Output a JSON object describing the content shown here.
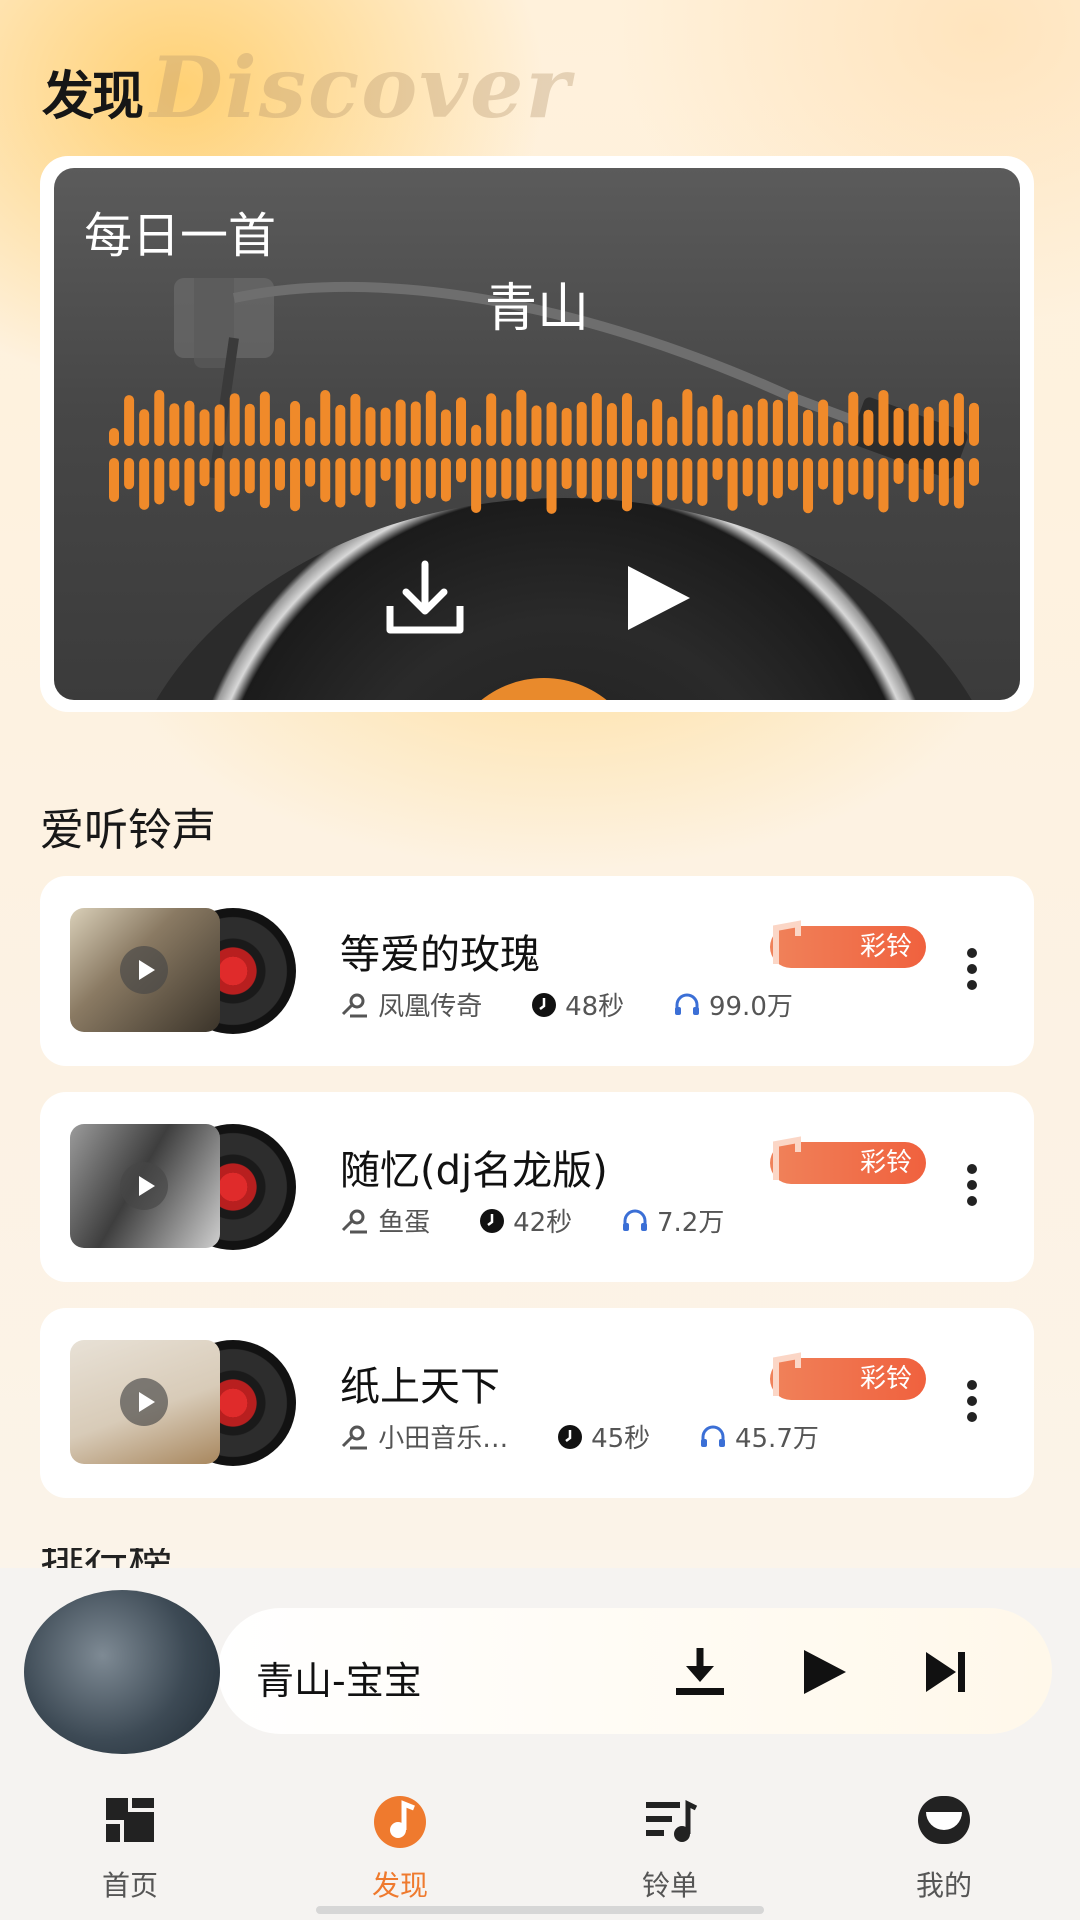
{
  "header": {
    "title_cn": "发现",
    "title_en": "Discover"
  },
  "daily": {
    "title": "每日一首",
    "song": "青山",
    "download_icon": "download-icon",
    "play_icon": "play-icon"
  },
  "section": {
    "title": "爱听铃声"
  },
  "songs": [
    {
      "name": "等爱的玫瑰",
      "artist": "凤凰传奇",
      "duration": "48秒",
      "plays": "99.0万",
      "badge": "彩铃"
    },
    {
      "name": "随忆(dj名龙版)",
      "artist": "鱼蛋",
      "duration": "42秒",
      "plays": "7.2万",
      "badge": "彩铃"
    },
    {
      "name": "纸上天下",
      "artist": "小田音乐…",
      "duration": "45秒",
      "plays": "45.7万",
      "badge": "彩铃"
    }
  ],
  "next_section": {
    "title": "排行榜"
  },
  "player": {
    "title": "青山-宝宝"
  },
  "tabs": [
    {
      "label": "首页",
      "icon": "home-grid-icon"
    },
    {
      "label": "发现",
      "icon": "discover-note-icon"
    },
    {
      "label": "铃单",
      "icon": "playlist-icon"
    },
    {
      "label": "我的",
      "icon": "profile-icon"
    }
  ],
  "colors": {
    "accent": "#ef7a2e",
    "badge": "#f0613e",
    "wave": "#f08a2a"
  }
}
